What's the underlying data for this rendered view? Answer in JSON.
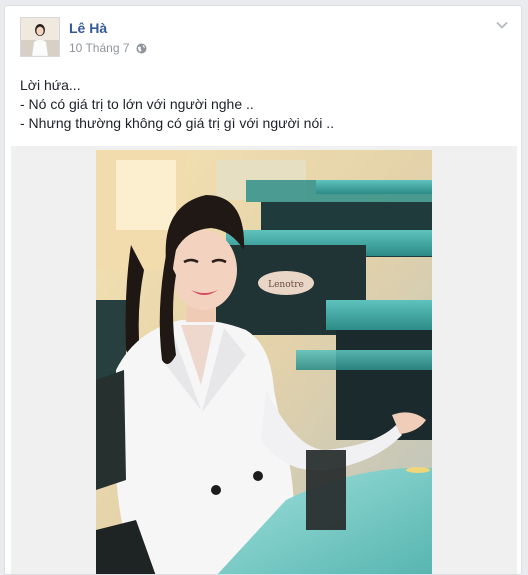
{
  "post": {
    "author": "Lê Hà",
    "timestamp": "10 Tháng 7",
    "privacy_icon": "globe-icon",
    "menu_icon": "chevron-down-icon",
    "lines": [
      "Lời hứa...",
      "- Nó có giá trị to lớn với người nghe ..",
      "- Nhưng thường không có giá trị gì với người nói .."
    ],
    "cafe_sign": "Lenotre"
  },
  "colors": {
    "link": "#365899",
    "meta": "#90949c",
    "text": "#1d2129"
  }
}
